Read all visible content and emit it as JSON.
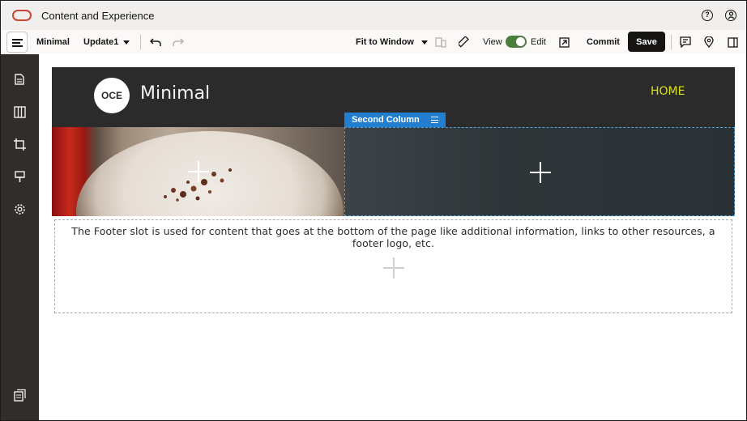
{
  "titlebar": {
    "app_title": "Content and Experience",
    "help_icon": "question-circle-icon",
    "user_icon": "user-circle-icon"
  },
  "toolbar": {
    "site_name": "Minimal",
    "update_name": "Update1",
    "fit_label": "Fit to Window",
    "view_label": "View",
    "edit_label": "Edit",
    "commit_label": "Commit",
    "save_label": "Save",
    "edit_mode_on": true
  },
  "sidebar": {
    "items": [
      "pages-icon",
      "components-icon",
      "crop-icon",
      "theme-brush-icon",
      "settings-gear-icon"
    ],
    "bottom_item": "assets-icon"
  },
  "site": {
    "logo_text": "OCE",
    "name": "Minimal",
    "nav_home": "HOME"
  },
  "slot": {
    "selected_label": "Second Column"
  },
  "footer": {
    "text": "The Footer slot is used for content that goes at the bottom of the page like additional information, links to other resources, a footer logo, etc."
  },
  "colors": {
    "accent_blue": "#227ecf",
    "toggle_green": "#4b7d3f",
    "home_link": "#d9e01f",
    "sidebar": "#312d2a",
    "oracle_red": "#c74634"
  }
}
